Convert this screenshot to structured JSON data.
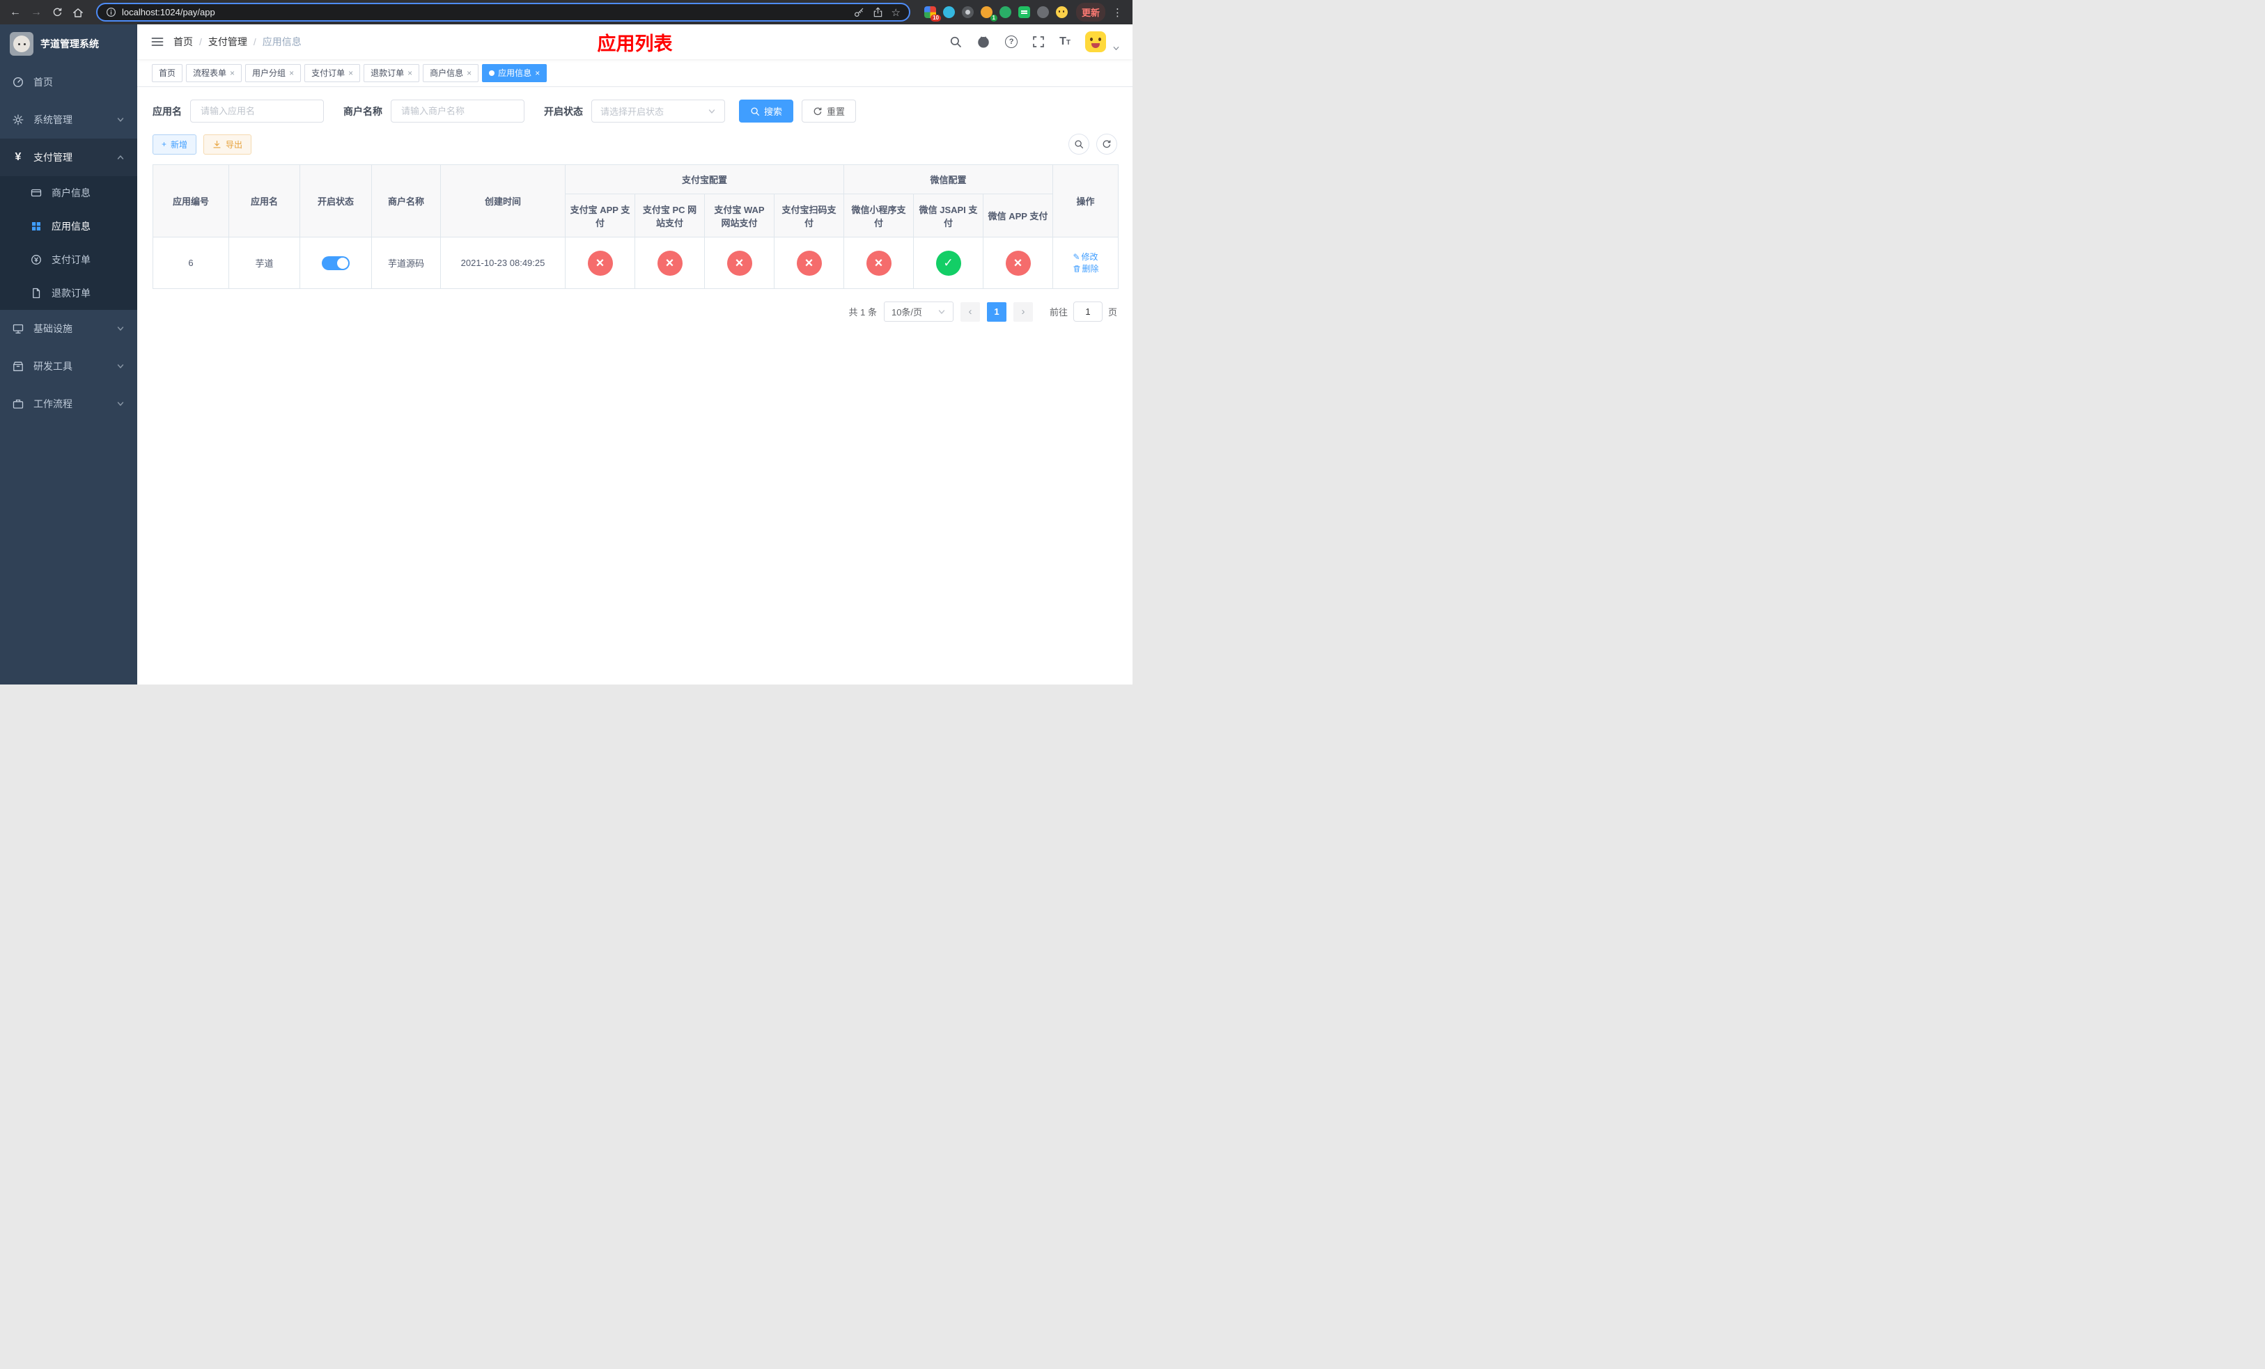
{
  "browser": {
    "url": "localhost:1024/pay/app",
    "update_label": "更新",
    "extension_badge_1": "10",
    "extension_badge_2": "1"
  },
  "sidebar": {
    "logo_title": "芋道管理系统",
    "menu": [
      {
        "label": "首页"
      },
      {
        "label": "系统管理"
      },
      {
        "label": "支付管理"
      },
      {
        "label": "基础设施"
      },
      {
        "label": "研发工具"
      },
      {
        "label": "工作流程"
      }
    ],
    "payment_children": [
      {
        "label": "商户信息"
      },
      {
        "label": "应用信息"
      },
      {
        "label": "支付订单"
      },
      {
        "label": "退款订单"
      }
    ]
  },
  "navbar": {
    "breadcrumb": [
      {
        "label": "首页"
      },
      {
        "label": "支付管理"
      },
      {
        "label": "应用信息"
      }
    ],
    "page_title": "应用列表"
  },
  "tabs": [
    {
      "label": "首页"
    },
    {
      "label": "流程表单"
    },
    {
      "label": "用户分组"
    },
    {
      "label": "支付订单"
    },
    {
      "label": "退款订单"
    },
    {
      "label": "商户信息"
    },
    {
      "label": "应用信息"
    }
  ],
  "filter": {
    "app_name_label": "应用名",
    "app_name_placeholder": "请输入应用名",
    "merchant_label": "商户名称",
    "merchant_placeholder": "请输入商户名称",
    "status_label": "开启状态",
    "status_placeholder": "请选择开启状态",
    "search_label": "搜索",
    "reset_label": "重置"
  },
  "toolbar": {
    "add_label": "新增",
    "export_label": "导出"
  },
  "table": {
    "headers": {
      "app_id": "应用编号",
      "app_name": "应用名",
      "status": "开启状态",
      "merchant_name": "商户名称",
      "create_time": "创建时间",
      "alipay_group": "支付宝配置",
      "wechat_group": "微信配置",
      "alipay_app": "支付宝 APP 支付",
      "alipay_pc": "支付宝 PC 网站支付",
      "alipay_wap": "支付宝 WAP 网站支付",
      "alipay_qr": "支付宝扫码支付",
      "wechat_mini": "微信小程序支付",
      "wechat_jsapi": "微信 JSAPI 支付",
      "wechat_app": "微信 APP 支付",
      "actions": "操作"
    },
    "row": {
      "app_id": "6",
      "app_name": "芋道",
      "status_on": "on",
      "merchant_name": "芋道源码",
      "create_time": "2021-10-23 08:49:25",
      "channels": [
        {
          "name": "alipay_app",
          "state": "off"
        },
        {
          "name": "alipay_pc",
          "state": "off"
        },
        {
          "name": "alipay_wap",
          "state": "off"
        },
        {
          "name": "alipay_qr",
          "state": "off"
        },
        {
          "name": "wechat_mini",
          "state": "off"
        },
        {
          "name": "wechat_jsapi",
          "state": "on"
        },
        {
          "name": "wechat_app",
          "state": "off"
        }
      ],
      "edit_label": "修改",
      "delete_label": "删除"
    }
  },
  "pagination": {
    "total_text": "共 1 条",
    "page_size_text": "10条/页",
    "current_page": "1",
    "prev_icon": "‹",
    "next_icon": "›",
    "goto_label": "前往",
    "goto_value": "1",
    "goto_unit": "页"
  },
  "colors": {
    "accent": "#409eff",
    "danger": "#f56c6c",
    "success": "#13ce66",
    "warning": "#e6a23c",
    "title_red": "#ff0000",
    "sidebar_bg": "#304156",
    "submenu_bg": "#1f2d3d"
  }
}
